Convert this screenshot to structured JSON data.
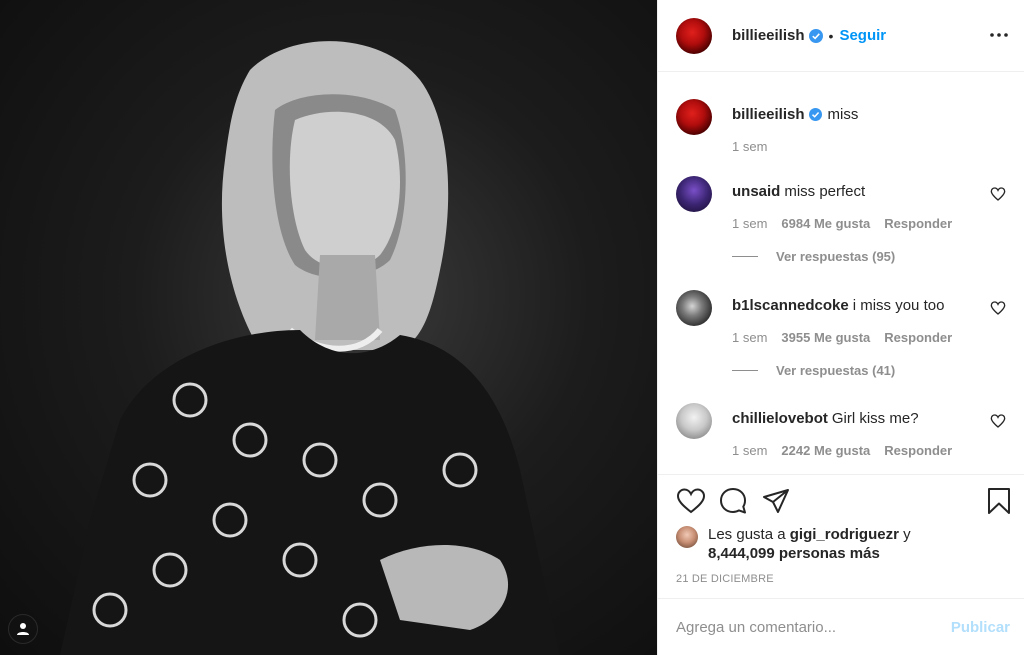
{
  "post": {
    "username": "billieeilish",
    "follow_label": "Seguir",
    "dot": "•",
    "caption": "miss",
    "caption_time": "1 sem"
  },
  "comments": [
    {
      "username": "unsaid",
      "text": "miss perfect",
      "time": "1 sem",
      "likes": "6984 Me gusta",
      "reply": "Responder",
      "view_replies": "Ver respuestas (95)"
    },
    {
      "username": "b1lscannedcoke",
      "text": "i miss you too",
      "time": "1 sem",
      "likes": "3955 Me gusta",
      "reply": "Responder",
      "view_replies": "Ver respuestas (41)"
    },
    {
      "username": "chillielovebot",
      "text": "Girl kiss me?",
      "time": "1 sem",
      "likes": "2242 Me gusta",
      "reply": "Responder"
    }
  ],
  "likes": {
    "prefix": "Les gusta a",
    "user": "gigi_rodriguezr",
    "conj": "y",
    "others": "8,444,099 personas más"
  },
  "date": "21 DE DICIEMBRE",
  "compose": {
    "placeholder": "Agrega un comentario...",
    "publish_label": "Publicar"
  },
  "icons": {
    "verified": "verified-badge-icon",
    "more": "more-options-icon",
    "like": "heart-icon",
    "comment": "comment-icon",
    "share": "paper-plane-icon",
    "save": "bookmark-icon",
    "user_tags": "user-tag-icon"
  },
  "colors": {
    "accent": "#0095f6",
    "verified": "#3897f0",
    "muted": "#8e8e8e",
    "publish_disabled": "#b2dffc"
  }
}
